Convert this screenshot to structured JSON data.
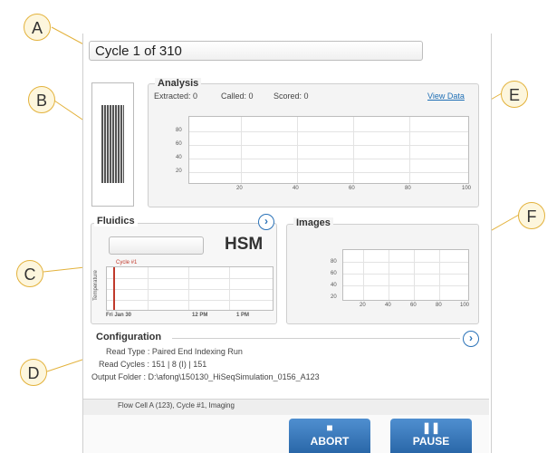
{
  "callouts": [
    "A",
    "B",
    "C",
    "D",
    "E",
    "F"
  ],
  "cycle_title": "Cycle 1 of 310",
  "analysis": {
    "title": "Analysis",
    "extracted": "Extracted: 0",
    "called": "Called: 0",
    "scored": "Scored: 0",
    "view_data": "View Data",
    "y_ticks": [
      "80",
      "60",
      "40",
      "20"
    ],
    "x_ticks": [
      "20",
      "40",
      "60",
      "80",
      "100"
    ]
  },
  "fluidics": {
    "title": "Fluidics",
    "mode": "HSM",
    "y_label": "Temperature",
    "marker_label": "Cycle #1",
    "x_ticks": [
      "Fri Jan 30",
      "12 PM",
      "1 PM"
    ]
  },
  "images": {
    "title": "Images",
    "y_ticks": [
      "80",
      "60",
      "40",
      "20"
    ],
    "x_ticks": [
      "20",
      "40",
      "60",
      "80",
      "100"
    ]
  },
  "configuration": {
    "title": "Configuration",
    "read_type": "Read Type : Paired End Indexing Run",
    "read_cycles": "Read Cycles : 151 | 8 (I) | 151",
    "output_folder": "Output Folder : D:\\afong\\150130_HiSeqSimulation_0156_A123"
  },
  "status_text": "Flow Cell A (123), Cycle #1, Imaging",
  "buttons": {
    "abort": "ABORT",
    "pause": "PAUSE",
    "abort_icon": "stop-icon",
    "pause_icon": "pause-icon"
  },
  "colors": {
    "accent": "#2a72b8",
    "callout_border": "#e3b23c",
    "marker": "#c0392b"
  }
}
